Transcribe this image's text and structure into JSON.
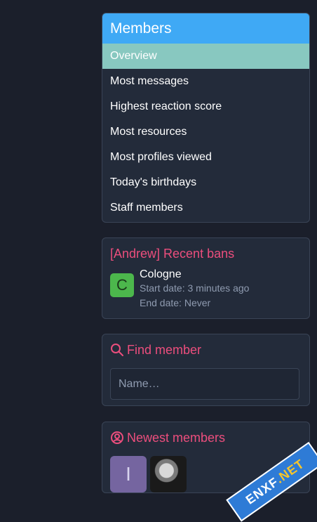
{
  "members_block": {
    "title": "Members",
    "items": [
      {
        "label": "Overview",
        "active": true
      },
      {
        "label": "Most messages"
      },
      {
        "label": "Highest reaction score"
      },
      {
        "label": "Most resources"
      },
      {
        "label": "Most profiles viewed"
      },
      {
        "label": "Today's birthdays"
      },
      {
        "label": "Staff members"
      }
    ]
  },
  "bans_block": {
    "title": "[Andrew] Recent bans",
    "entry": {
      "avatar_letter": "C",
      "username": "Cologne",
      "start": "Start date: 3 minutes ago",
      "end": "End date: Never"
    }
  },
  "find_block": {
    "title": "Find member",
    "icon": "search-icon",
    "placeholder": "Name…"
  },
  "newest_block": {
    "title": "Newest members",
    "icon": "user-circle-icon",
    "avatar_letter": "I"
  },
  "watermark": {
    "text": "ENXF",
    "suffix": ".NET"
  },
  "colors": {
    "accent": "#3fa9f5",
    "active": "#88c8c0",
    "title": "#ec4e7d",
    "avatar_green": "#4cb74c"
  }
}
